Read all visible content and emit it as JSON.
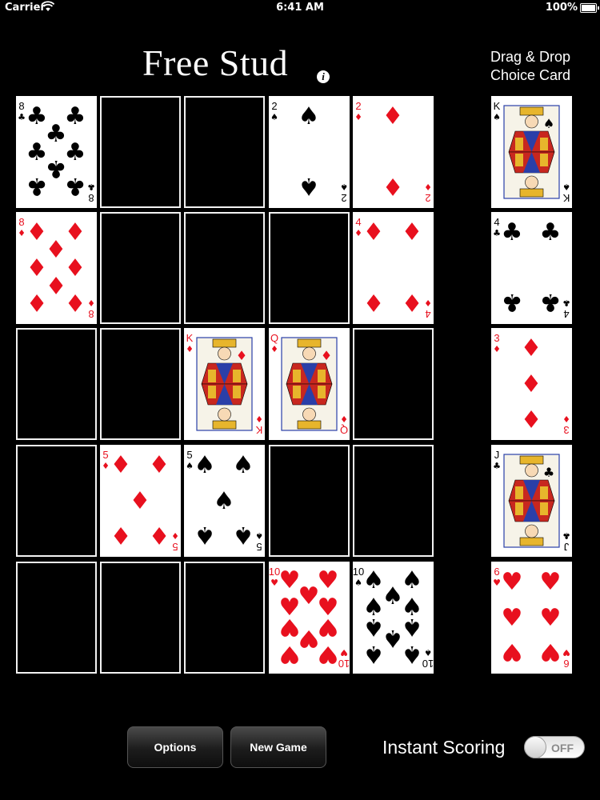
{
  "status_bar": {
    "carrier": "Carrier",
    "time": "6:41 AM",
    "battery": "100%"
  },
  "header": {
    "title": "Free Stud",
    "info_icon": "i",
    "drag_label": "Drag & Drop Choice Card"
  },
  "colors": {
    "red_suit": "#e8101e",
    "black_suit": "#000000",
    "slot_border": "#f2f2f2"
  },
  "board": [
    [
      {
        "rank": "8",
        "suit": "clubs"
      },
      null,
      null,
      {
        "rank": "2",
        "suit": "spades"
      },
      {
        "rank": "2",
        "suit": "diamonds"
      }
    ],
    [
      {
        "rank": "8",
        "suit": "diamonds"
      },
      null,
      null,
      null,
      {
        "rank": "4",
        "suit": "diamonds"
      }
    ],
    [
      null,
      null,
      {
        "rank": "K",
        "suit": "diamonds"
      },
      {
        "rank": "Q",
        "suit": "diamonds"
      },
      null
    ],
    [
      null,
      {
        "rank": "5",
        "suit": "diamonds"
      },
      {
        "rank": "5",
        "suit": "spades"
      },
      null,
      null
    ],
    [
      null,
      null,
      null,
      {
        "rank": "10",
        "suit": "hearts"
      },
      {
        "rank": "10",
        "suit": "spades"
      }
    ]
  ],
  "choice_cards": [
    {
      "rank": "K",
      "suit": "spades"
    },
    {
      "rank": "4",
      "suit": "clubs"
    },
    {
      "rank": "3",
      "suit": "diamonds"
    },
    {
      "rank": "J",
      "suit": "clubs"
    },
    {
      "rank": "6",
      "suit": "hearts"
    }
  ],
  "controls": {
    "options_label": "Options",
    "new_game_label": "New Game",
    "instant_scoring_label": "Instant Scoring",
    "toggle_state": "OFF"
  }
}
